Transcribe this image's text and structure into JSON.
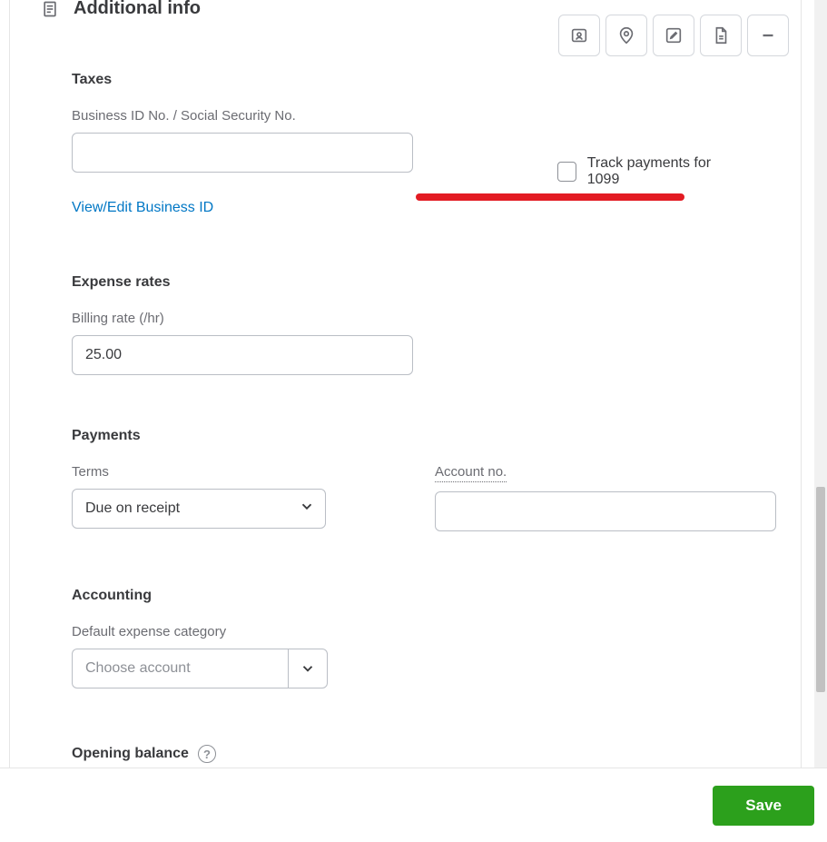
{
  "header": {
    "title": "Additional info"
  },
  "taxes": {
    "heading": "Taxes",
    "business_id_label": "Business ID No. / Social Security No.",
    "business_id_value": "",
    "view_edit_link": "View/Edit Business ID",
    "track_1099_label": "Track payments for 1099"
  },
  "expense_rates": {
    "heading": "Expense rates",
    "billing_rate_label": "Billing rate (/hr)",
    "billing_rate_value": "25.00"
  },
  "payments": {
    "heading": "Payments",
    "terms_label": "Terms",
    "terms_value": "Due on receipt",
    "account_no_label": "Account no.",
    "account_no_value": ""
  },
  "accounting": {
    "heading": "Accounting",
    "default_category_label": "Default expense category",
    "default_category_placeholder": "Choose account"
  },
  "opening_balance": {
    "heading": "Opening balance"
  },
  "footer": {
    "save_label": "Save"
  }
}
